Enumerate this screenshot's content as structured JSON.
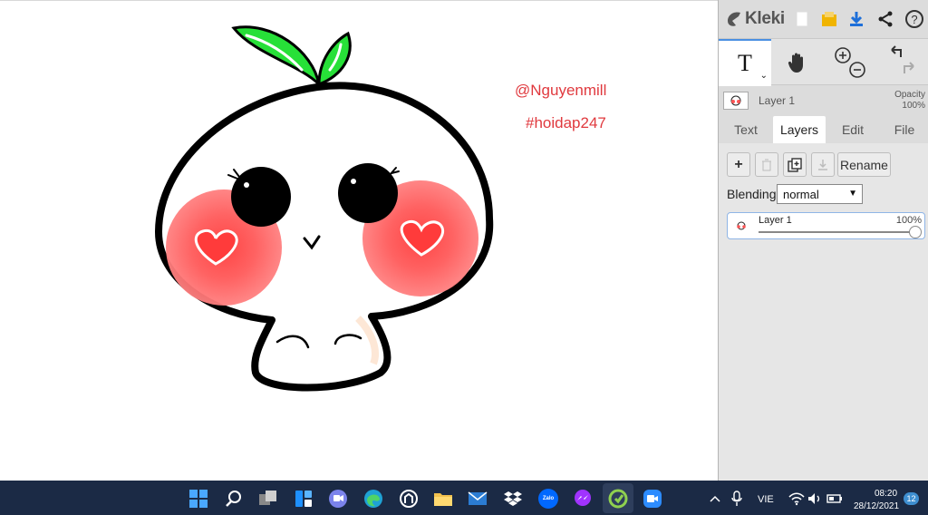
{
  "canvas": {
    "watermark_name": "@Nguyenmill",
    "watermark_tag": "#hoidap247"
  },
  "panel": {
    "app_name": "Kleki",
    "layer_name": "Layer 1",
    "opacity_label": "Opacity",
    "opacity_value": "100%",
    "tabs": [
      {
        "label": "Text"
      },
      {
        "label": "Layers"
      },
      {
        "label": "Edit"
      },
      {
        "label": "File"
      }
    ],
    "active_tab": "Layers",
    "rename_label": "Rename",
    "blending_label": "Blending",
    "blending_value": "normal",
    "layer_list": [
      {
        "name": "Layer 1",
        "opacity": "100%",
        "opacity_fraction": 1.0
      }
    ],
    "colors": {
      "accent": "#4a90e2",
      "save_icon": "#f0b400",
      "download_icon": "#1e6fd9"
    }
  },
  "taskbar": {
    "language": "VIE",
    "time": "08:20",
    "date": "28/12/2021",
    "notification_count": "12",
    "zalo_label": "Zalo"
  }
}
